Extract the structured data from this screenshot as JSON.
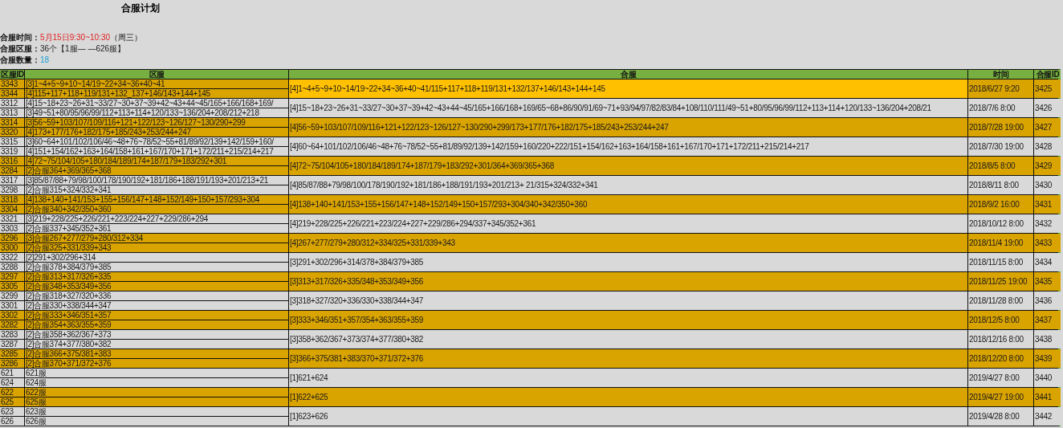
{
  "title": "合服计划",
  "info": [
    {
      "label": "合服时间：",
      "value": "5月15日9:30~10:30",
      "kind": "alert",
      "note": "（周三）"
    },
    {
      "label": "合服区服：",
      "value": "36个【1服— —626服】",
      "kind": "plain"
    },
    {
      "label": "合服数量：",
      "value": "18",
      "kind": "count"
    }
  ],
  "columns": [
    "区服ID",
    "区服",
    "合服",
    "时间",
    "合服ID"
  ],
  "groups": [
    {
      "servers": [
        {
          "id": "3343",
          "regions": "[3]1~4+5~9+10~14/19~22+34~36+40~41"
        },
        {
          "id": "3344",
          "regions": "[4]115+117+118+119/131+132_137+146/143+144+145"
        }
      ],
      "merged": "[4]1~4+5~9+10~14/19~22+34~36+40~41/115+117+118+119/131+132/137+146/143+144+145",
      "time": "2018/6/27 9:20",
      "merge_id": "3425",
      "highlighted": true
    },
    {
      "servers": [
        {
          "id": "3312",
          "regions": "[4]15~18+23~26+31~33/27~30+37~39+42~43+44~45/165+166/168+169/"
        },
        {
          "id": "3313",
          "regions": "[3]49~51+80/95/96/99/112+113+114+120/133~136/204+208/212+218"
        }
      ],
      "merged": "[4]15~18+23~26+31~33/27~30+37~39+42~43+44~45/165+166/168+169/65~68+86/90/91/69~71+93/94/97/82/83/84+108/110/111/49~51+80/95/96/99/112+113+114+120/133~136/204+208/21",
      "time": "2018/7/6 8:00",
      "merge_id": "3426",
      "highlighted": false
    },
    {
      "servers": [
        {
          "id": "3314",
          "regions": "[3]56~59+103/107/109/116+121+122/123~126/127~130/290+299"
        },
        {
          "id": "3320",
          "regions": "[4]173+177/176+182/175+185/243+253/244+247"
        }
      ],
      "merged": "[4]56~59+103/107/109/116+121+122/123~126/127~130/290+299/173+177/176+182/175+185/243+253/244+247",
      "time": "2018/7/28 19:00",
      "merge_id": "3427",
      "highlighted": false
    },
    {
      "servers": [
        {
          "id": "3315",
          "regions": "[3]60~64+101/102/106/46~48+76~78/52~55+81/89/92/139+142/159+160/"
        },
        {
          "id": "3319",
          "regions": "[4]151+154/162+163+164/158+161+167/170+171+172/211+215/214+217"
        }
      ],
      "merged": "[4]60~64+101/102/106/46~48+76~78/52~55+81/89/92/139+142/159+160/220+222/151+154/162+163+164/158+161+167/170+171+172/211+215/214+217",
      "time": "2018/7/30 19:00",
      "merge_id": "3428",
      "highlighted": false
    },
    {
      "servers": [
        {
          "id": "3316",
          "regions": "[4]72~75/104/105+180/184/189/174+187/179+183/292+301"
        },
        {
          "id": "3284",
          "regions": "[2]合服364+369/365+368"
        }
      ],
      "merged": "[4]72~75/104/105+180/184/189/174+187/179+183/292+301/364+369/365+368",
      "time": "2018/8/5 8:00",
      "merge_id": "3429",
      "highlighted": false
    },
    {
      "servers": [
        {
          "id": "3317",
          "regions": "[3]85/87/88+79/98/100/178/190/192+181/186+188/191/193+201/213+21"
        },
        {
          "id": "3298",
          "regions": "[2]合服315+324/332+341"
        }
      ],
      "merged": "[4]85/87/88+79/98/100/178/190/192+181/186+188/191/193+201/213+ 21/315+324/332+341",
      "time": "2018/8/11 8:00",
      "merge_id": "3430",
      "highlighted": false
    },
    {
      "servers": [
        {
          "id": "3318",
          "regions": "[4]138+140+141/153+155+156/147+148+152/149+150+157/293+304"
        },
        {
          "id": "3304",
          "regions": "[2]合服340+342/350+360"
        }
      ],
      "merged": "[4]138+140+141/153+155+156/147+148+152/149+150+157/293+304/340+342/350+360",
      "time": "2018/9/2 16:00",
      "merge_id": "3431",
      "highlighted": false
    },
    {
      "servers": [
        {
          "id": "3321",
          "regions": "[3]219+228/225+226/221+223/224+227+229/286+294"
        },
        {
          "id": "3303",
          "regions": "[2]合服337+345/352+361"
        }
      ],
      "merged": "[4]219+228/225+226/221+223/224+227+229/286+294/337+345/352+361",
      "time": "2018/10/12 8:00",
      "merge_id": "3432",
      "highlighted": false
    },
    {
      "servers": [
        {
          "id": "3296",
          "regions": "[3]合服267+277/279+280/312+334"
        },
        {
          "id": "3300",
          "regions": "[2]合服325+331/339+343"
        }
      ],
      "merged": "[4]267+277/279+280/312+334/325+331/339+343",
      "time": "2018/11/4 19:00",
      "merge_id": "3433",
      "highlighted": false
    },
    {
      "servers": [
        {
          "id": "3322",
          "regions": "[2]291+302/296+314"
        },
        {
          "id": "3288",
          "regions": "[2]合服378+384/379+385"
        }
      ],
      "merged": "[3]291+302/296+314/378+384/379+385",
      "time": "2018/11/15 8:00",
      "merge_id": "3434",
      "highlighted": false
    },
    {
      "servers": [
        {
          "id": "3297",
          "regions": "[2]合服313+317/326+335"
        },
        {
          "id": "3305",
          "regions": "[2]合服348+353/349+356"
        }
      ],
      "merged": "[3]313+317/326+335/348+353/349+356",
      "time": "2018/11/25 19:00",
      "merge_id": "3435",
      "highlighted": false
    },
    {
      "servers": [
        {
          "id": "3299",
          "regions": "[2]合服318+327/320+336"
        },
        {
          "id": "3301",
          "regions": "[2]合服330+338/344+347"
        }
      ],
      "merged": "[3]318+327/320+336/330+338/344+347",
      "time": "2018/11/28 8:00",
      "merge_id": "3436",
      "highlighted": false
    },
    {
      "servers": [
        {
          "id": "3302",
          "regions": "[2]合服333+346/351+357"
        },
        {
          "id": "3282",
          "regions": "[2]合服354+363/355+359"
        }
      ],
      "merged": "[3]333+346/351+357/354+363/355+359",
      "time": "2018/12/5 8:00",
      "merge_id": "3437",
      "highlighted": false
    },
    {
      "servers": [
        {
          "id": "3283",
          "regions": "[2]合服358+362/367+373"
        },
        {
          "id": "3287",
          "regions": "[2]合服374+377/380+382"
        }
      ],
      "merged": "[3]358+362/367+373/374+377/380+382",
      "time": "2018/12/16 8:00",
      "merge_id": "3438",
      "highlighted": false
    },
    {
      "servers": [
        {
          "id": "3285",
          "regions": "[2]合服366+375/381+383"
        },
        {
          "id": "3286",
          "regions": "[2]合服370+371/372+376"
        }
      ],
      "merged": "[3]366+375/381+383/370+371/372+376",
      "time": "2018/12/20 8:00",
      "merge_id": "3439",
      "highlighted": false
    },
    {
      "servers": [
        {
          "id": "621",
          "regions": "621服"
        },
        {
          "id": "624",
          "regions": "624服"
        }
      ],
      "merged": "[1]621+624",
      "time": "2019/4/27 8:00",
      "merge_id": "3440",
      "highlighted": false
    },
    {
      "servers": [
        {
          "id": "622",
          "regions": "622服"
        },
        {
          "id": "625",
          "regions": "625服"
        }
      ],
      "merged": "[1]622+625",
      "time": "2019/4/27 19:00",
      "merge_id": "3441",
      "highlighted": false
    },
    {
      "servers": [
        {
          "id": "623",
          "regions": "623服"
        },
        {
          "id": "626",
          "regions": "626服"
        }
      ],
      "merged": "[1]623+626",
      "time": "2019/4/28 8:00",
      "merge_id": "3442",
      "highlighted": false
    }
  ]
}
